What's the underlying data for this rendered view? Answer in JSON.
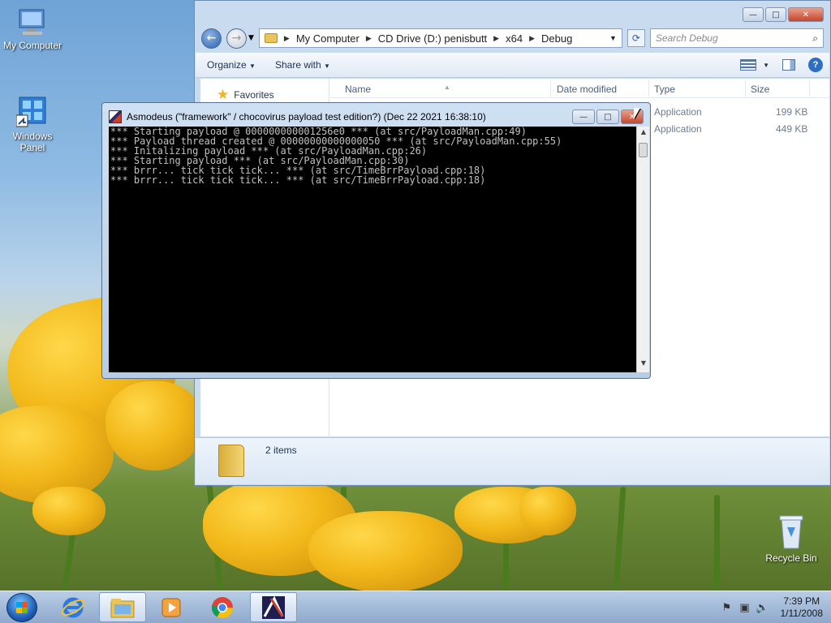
{
  "desktop": {
    "icons": [
      {
        "label": "My Computer"
      },
      {
        "label": "Windows\nPanel"
      },
      {
        "label": "Recycle Bin"
      }
    ]
  },
  "explorer": {
    "breadcrumb": [
      "My Computer",
      "CD Drive (D:) penisbutt",
      "x64",
      "Debug"
    ],
    "search_placeholder": "Search Debug",
    "toolbar": {
      "organize": "Organize",
      "share_with": "Share with"
    },
    "navpane": {
      "favorites": "Favorites"
    },
    "columns": {
      "name": "Name",
      "date_modified": "Date modified",
      "type": "Type",
      "size": "Size"
    },
    "files": [
      {
        "type": "Application",
        "size": "199 KB"
      },
      {
        "type": "Application",
        "size": "449 KB"
      }
    ],
    "status": {
      "item_count": "2 items"
    }
  },
  "console": {
    "title": "Asmodeus (\"framework\" / chocovirus payload test edition?) (Dec 22 2021 16:38:10)",
    "lines": [
      "*** Starting payload @ 000000000001256e0 *** (at src/PayloadMan.cpp:49)",
      "*** Payload thread created @ 00000000000000050 *** (at src/PayloadMan.cpp:55)",
      "*** Initalizing payload *** (at src/PayloadMan.cpp:26)",
      "*** Starting payload *** (at src/PayloadMan.cpp:30)",
      "*** brrr... tick tick tick... *** (at src/TimeBrrPayload.cpp:18)",
      "*** brrr... tick tick tick... *** (at src/TimeBrrPayload.cpp:18)"
    ]
  },
  "taskbar": {
    "pinned": [
      "internet-explorer-icon",
      "explorer-folder-icon",
      "media-player-icon",
      "chrome-icon",
      "asmodeus-app-icon"
    ],
    "clock": {
      "time": "7:39 PM",
      "date": "1/11/2008"
    }
  },
  "colors": {
    "console_bg": "#000000",
    "console_text": "#c0c0c0",
    "accent": "#2d5fa8"
  }
}
